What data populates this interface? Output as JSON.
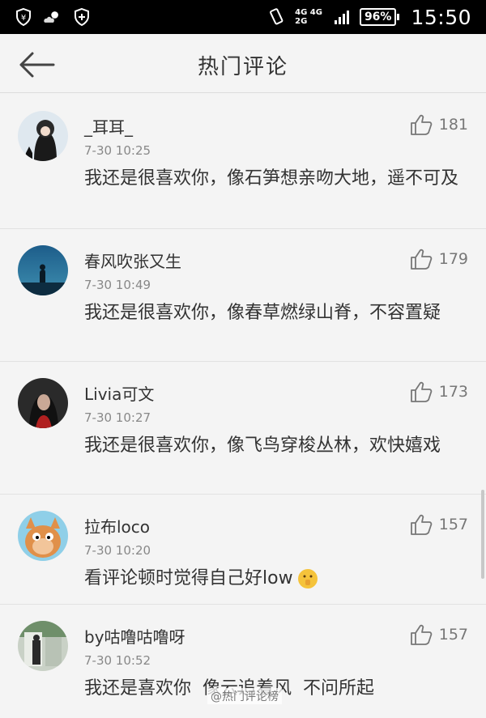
{
  "status_bar": {
    "network_top": "4G 4G",
    "network_bottom": "2G",
    "battery": "96%",
    "time": "15:50"
  },
  "header": {
    "title": "热门评论"
  },
  "comments": [
    {
      "username": "_耳耳_",
      "time": "7-30 10:25",
      "likes": "181",
      "text": "我还是很喜欢你，像石笋想亲吻大地，遥不可及"
    },
    {
      "username": "春风吹张又生",
      "time": "7-30 10:49",
      "likes": "179",
      "text": "我还是很喜欢你，像春草燃绿山脊，不容置疑"
    },
    {
      "username": "Livia可文",
      "time": "7-30 10:27",
      "likes": "173",
      "text": "我还是很喜欢你，像飞鸟穿梭丛林，欢快嬉戏"
    },
    {
      "username": "拉布loco",
      "time": "7-30 10:20",
      "likes": "157",
      "text": "看评论顿时觉得自己好low"
    },
    {
      "username": "by咕噜咕噜呀",
      "time": "7-30 10:52",
      "likes": "157",
      "text": "我还是喜欢你  像云追着风  不问所起"
    }
  ],
  "watermark": "@热门评论榜",
  "colors": {
    "status_bar_bg": "#000000",
    "page_bg": "#f4f4f4",
    "text": "#333333",
    "meta": "#888888"
  }
}
